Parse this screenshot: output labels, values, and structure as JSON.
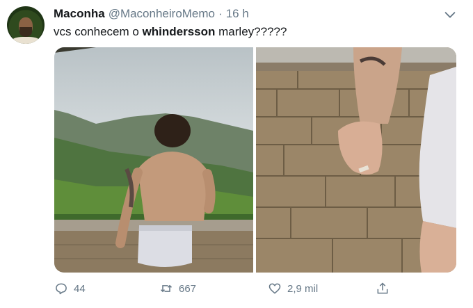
{
  "tweet": {
    "author_name": "Maconha",
    "author_handle": "@MaconheiroMemo",
    "separator": "·",
    "time": "16 h",
    "text_before": "vcs conhecem o ",
    "text_bold": "whindersson",
    "text_after": " marley?????"
  },
  "actions": {
    "replies": "44",
    "retweets": "667",
    "likes": "2,9 mil"
  },
  "icons": [
    "chevron-down-icon",
    "reply-icon",
    "retweet-icon",
    "like-icon",
    "share-icon"
  ],
  "colors": {
    "muted": "#657786",
    "text": "#14171a"
  }
}
